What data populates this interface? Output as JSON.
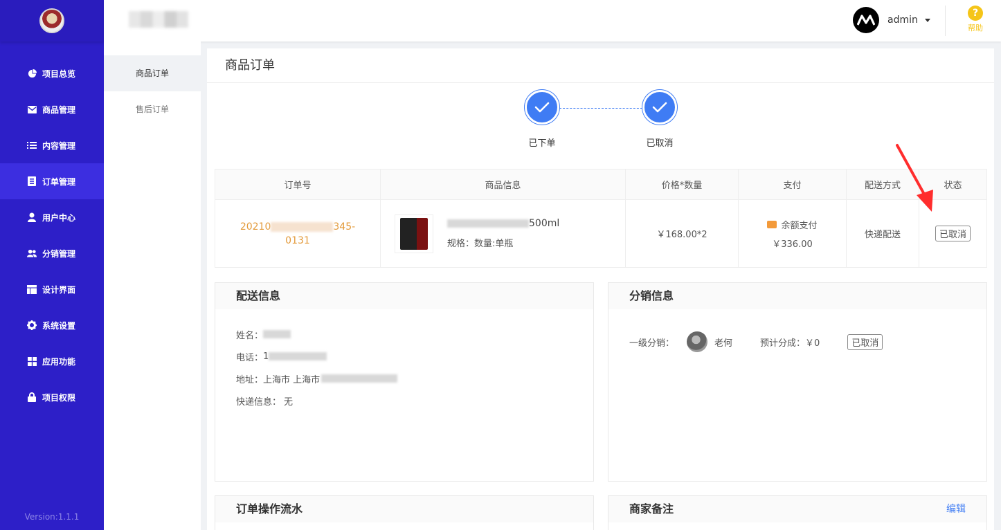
{
  "sidebar": {
    "items": [
      {
        "label": "项目总览",
        "icon": "pie-chart-icon"
      },
      {
        "label": "商品管理",
        "icon": "mail-icon"
      },
      {
        "label": "内容管理",
        "icon": "list-icon"
      },
      {
        "label": "订单管理",
        "icon": "document-icon"
      },
      {
        "label": "用户中心",
        "icon": "user-icon"
      },
      {
        "label": "分销管理",
        "icon": "users-icon"
      },
      {
        "label": "设计界面",
        "icon": "layout-icon"
      },
      {
        "label": "系统设置",
        "icon": "gear-icon"
      },
      {
        "label": "应用功能",
        "icon": "grid-icon"
      },
      {
        "label": "项目权限",
        "icon": "lock-icon"
      }
    ],
    "active_index": 3,
    "version": "Version:1.1.1"
  },
  "topbar": {
    "user_name": "admin",
    "help_label": "帮助"
  },
  "subnav": {
    "items": [
      "商品订单",
      "售后订单"
    ]
  },
  "page": {
    "title": "商品订单"
  },
  "steps": [
    "已下单",
    "已取消"
  ],
  "order_table": {
    "headers": [
      "订单号",
      "商品信息",
      "价格*数量",
      "支付",
      "配送方式",
      "状态"
    ],
    "row": {
      "order_no_line1_start": "20210",
      "order_no_line1_end": "345-",
      "order_no_line2": "0131",
      "goods_name_suffix": "500ml",
      "goods_spec": "规格：数量:单瓶",
      "price_qty": "￥168.00*2",
      "pay_method": "余额支付",
      "pay_amount": "￥336.00",
      "delivery": "快递配送",
      "status": "已取消"
    }
  },
  "delivery_panel": {
    "title": "配送信息",
    "name_label": "姓名：",
    "phone_label": "电话：",
    "phone_prefix": "1",
    "address_label": "地址：",
    "address_value": "上海市 上海市",
    "express_label": "快递信息：",
    "express_value": "无"
  },
  "distribution_panel": {
    "title": "分销信息",
    "level_label": "一级分销：",
    "distributor_name": "老何",
    "commission_label": "预计分成：",
    "commission_value": "￥0",
    "status": "已取消"
  },
  "flow_panel": {
    "title": "订单操作流水"
  },
  "remark_panel": {
    "title": "商家备注",
    "edit_label": "编辑"
  },
  "colors": {
    "sidebar_bg": "#2d1fc8",
    "accent_blue": "#3f7cf4",
    "order_no": "#e39a3a",
    "help_yellow": "#f5c518"
  }
}
